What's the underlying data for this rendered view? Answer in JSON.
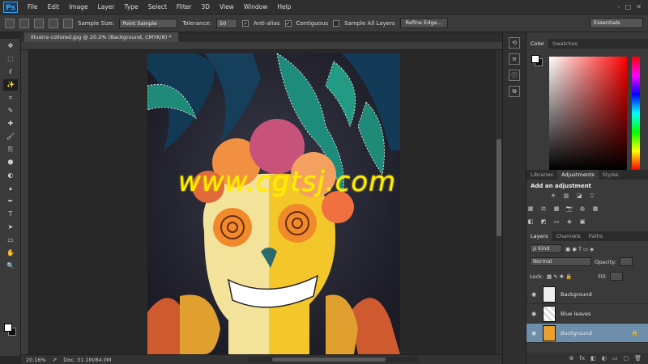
{
  "menubar": {
    "logo": "Ps",
    "items": [
      "File",
      "Edit",
      "Image",
      "Layer",
      "Type",
      "Select",
      "Filter",
      "3D",
      "View",
      "Window",
      "Help"
    ],
    "window_controls": [
      "–",
      "□",
      "✕"
    ]
  },
  "options": {
    "sample_size_label": "Sample Size:",
    "sample_size_value": "Point Sample",
    "tolerance_label": "Tolerance:",
    "tolerance_value": "50",
    "antialias_label": "Anti-alias",
    "contiguous_label": "Contiguous",
    "sample_all_label": "Sample All Layers",
    "refine_edge_label": "Refine Edge...",
    "workspace_value": "Essentials"
  },
  "tools": [
    "✥",
    "⬚",
    "ℓ",
    "✨",
    "⌗",
    "✎",
    "✚",
    "🖌",
    "⎘",
    "⬢",
    "◐",
    "▴",
    "✒",
    "T",
    "➤",
    "▭",
    "✋",
    "🔍"
  ],
  "document": {
    "tab_label": "Illustra collored.jpg @ 20.2% (Background, CMYK/8) *",
    "zoom": "20.16%",
    "doc_info": "Doc: 31.1M/84.0M"
  },
  "watermark": "www.cgtsj.com",
  "color_panel": {
    "tabs": [
      "Color",
      "Swatches"
    ]
  },
  "adjustments_panel": {
    "tabs": [
      "Libraries",
      "Adjustments",
      "Styles"
    ],
    "title": "Add an adjustment",
    "row1": [
      "☀",
      "▥",
      "◪",
      "▽"
    ],
    "row2": [
      "▦",
      "⚖",
      "▩",
      "📷",
      "◍",
      "▦"
    ],
    "row3": [
      "◧",
      "◩",
      "▭",
      "◈",
      "▣"
    ]
  },
  "layers_panel": {
    "tabs": [
      "Layers",
      "Channels",
      "Paths"
    ],
    "kind_label": "ρ Kind",
    "blend_mode": "Normal",
    "opacity_label": "Opacity:",
    "lock_label": "Lock:",
    "fill_label": "Fill:",
    "layers": [
      {
        "name": "Background",
        "selected": false
      },
      {
        "name": "Blue leaves",
        "selected": false
      },
      {
        "name": "Background",
        "selected": true
      }
    ],
    "footer_icons": [
      "⊕",
      "fx",
      "◧",
      "◐",
      "▭",
      "▢",
      "🗑"
    ]
  }
}
